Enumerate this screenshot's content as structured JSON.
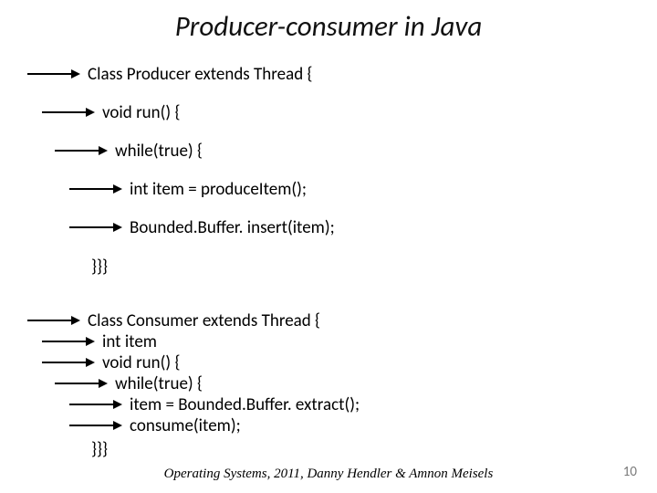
{
  "title": "Producer-consumer in Java",
  "block1": {
    "l1": "Class Producer extends Thread {",
    "l2": "void run() {",
    "l3": "while(true) {",
    "l4": "int item = produceItem();",
    "l5": "Bounded.Buffer. insert(item);",
    "close": "}}}"
  },
  "block2": {
    "l1": "Class Consumer extends Thread {",
    "l2": "int item",
    "l3": "void run() {",
    "l4": "while(true) {",
    "l5": "item = Bounded.Buffer. extract();",
    "l6": "consume(item);",
    "close": "}}}"
  },
  "footer": "Operating Systems, 2011, Danny Hendler & Amnon Meisels",
  "page": "10"
}
